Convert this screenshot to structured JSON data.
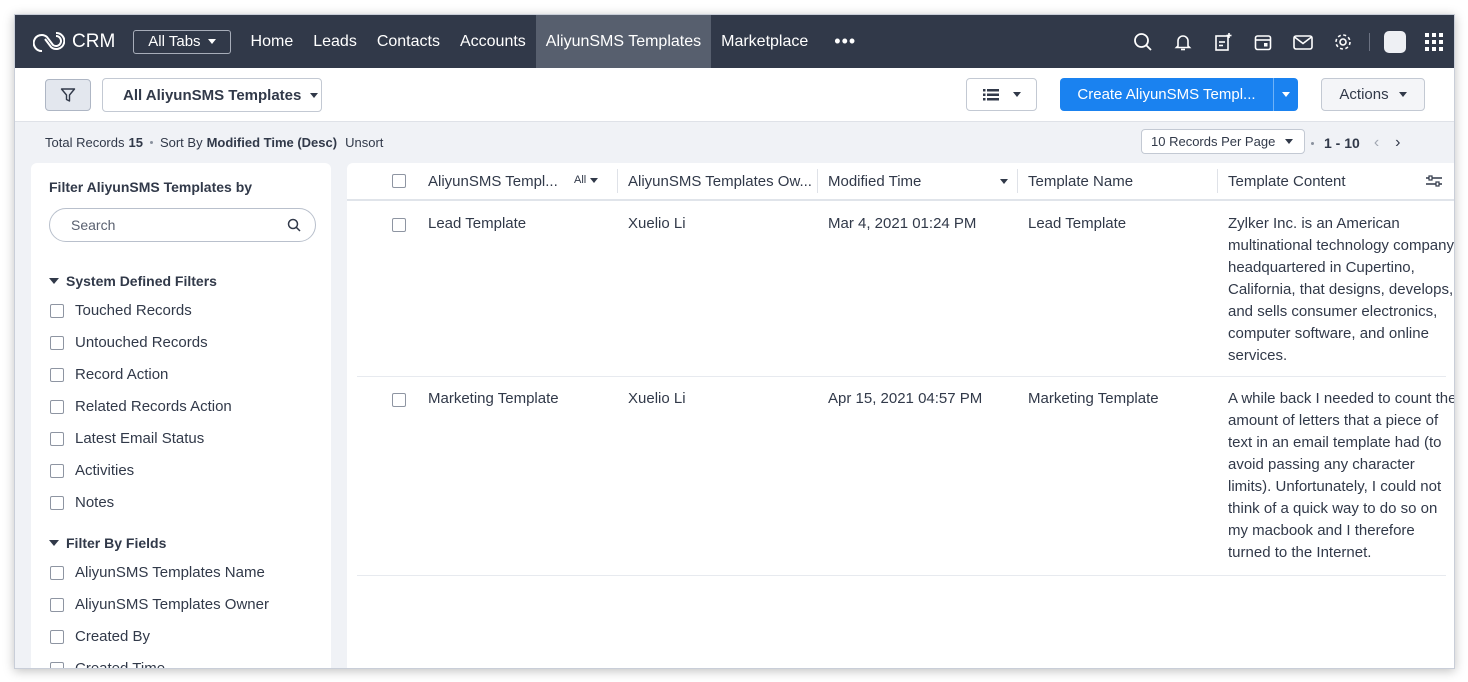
{
  "nav": {
    "logo_text": "CRM",
    "all_tabs": "All Tabs",
    "tabs": [
      {
        "label": "Home"
      },
      {
        "label": "Leads"
      },
      {
        "label": "Contacts"
      },
      {
        "label": "Accounts"
      },
      {
        "label": "AliyunSMS Templates",
        "active": true
      },
      {
        "label": "Marketplace"
      }
    ],
    "more": "•••",
    "icons": [
      "search-icon",
      "bell-icon",
      "add-note-icon",
      "calendar-icon",
      "mail-icon",
      "gear-icon",
      "avatar",
      "apps-grid-icon"
    ],
    "dark_color": "#313949",
    "active_tab_color": "#575f6e"
  },
  "toolbar": {
    "view_label": "All AliyunSMS Templates",
    "create_label": "Create AliyunSMS Templ...",
    "actions_label": "Actions",
    "accent": "#1a82f0"
  },
  "info": {
    "total_label": "Total Records",
    "total_value": "15",
    "sort_label": "Sort By",
    "sort_value": "Modified Time (Desc)",
    "unsort": "Unsort",
    "per_page": "10 Records Per Page",
    "range": "1 - 10"
  },
  "filters": {
    "title": "Filter AliyunSMS Templates by",
    "search_placeholder": "Search",
    "system_title": "System Defined Filters",
    "system_items": [
      "Touched Records",
      "Untouched Records",
      "Record Action",
      "Related Records Action",
      "Latest Email Status",
      "Activities",
      "Notes"
    ],
    "fields_title": "Filter By Fields",
    "field_items": [
      "AliyunSMS Templates Name",
      "AliyunSMS Templates Owner",
      "Created By",
      "Created Time"
    ]
  },
  "table": {
    "columns": [
      "AliyunSMS Templ...",
      "AliyunSMS Templates Ow...",
      "Modified Time",
      "Template Name",
      "Template Content"
    ],
    "all_label": "All",
    "rows": [
      {
        "name": "Lead Template",
        "owner": "Xuelio Li",
        "modified": "Mar 4, 2021 01:24 PM",
        "template_name": "Lead Template",
        "content": "Zylker Inc. is an American multinational technology company headquartered in Cupertino, California, that designs, develops, and sells consumer electronics, computer software, and online services."
      },
      {
        "name": "Marketing Template",
        "owner": "Xuelio Li",
        "modified": "Apr 15, 2021 04:57 PM",
        "template_name": "Marketing Template",
        "content": "A while back I needed to count the amount of letters that a piece of text in an email template had (to avoid passing any character limits). Unfortunately, I could not think of a quick way to do so on my macbook and I therefore turned to the Internet."
      }
    ]
  }
}
